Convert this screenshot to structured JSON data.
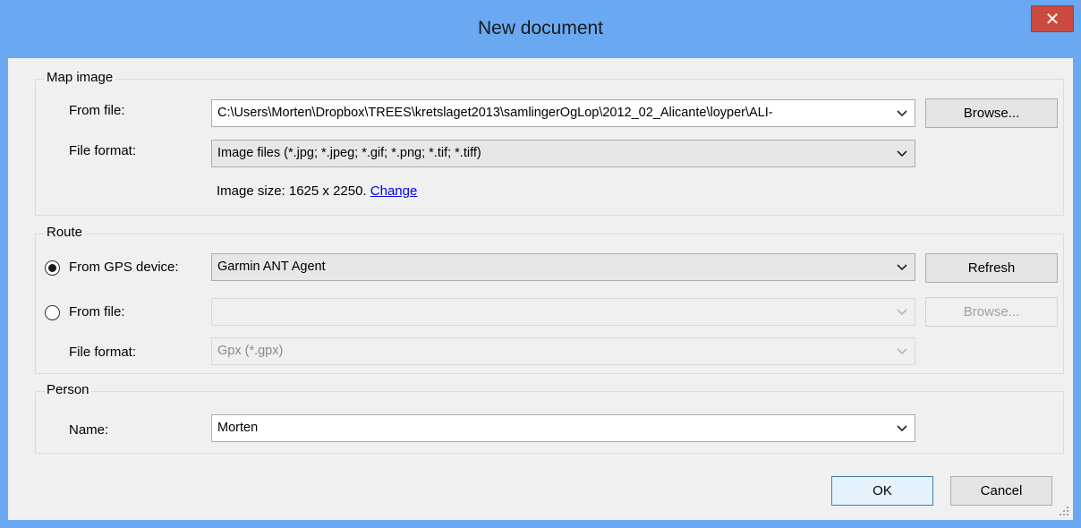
{
  "window": {
    "title": "New document",
    "close_glyph": "✕"
  },
  "map_image": {
    "group_label": "Map image",
    "from_file_label": "From file:",
    "from_file_value": "C:\\Users\\Morten\\Dropbox\\TREES\\kretslaget2013\\samlingerOgLop\\2012_02_Alicante\\loyper\\ALI-",
    "browse_label": "Browse...",
    "file_format_label": "File format:",
    "file_format_value": "Image files  (*.jpg; *.jpeg; *.gif; *.png; *.tif; *.tiff)",
    "image_size_text": "Image size: 1625 x 2250.",
    "change_link": "Change"
  },
  "route": {
    "group_label": "Route",
    "gps_label": "From GPS device:",
    "gps_value": "Garmin ANT Agent",
    "refresh_label": "Refresh",
    "from_file_label": "From file:",
    "from_file_value": "",
    "browse_label": "Browse...",
    "file_format_label": "File format:",
    "file_format_value": "Gpx (*.gpx)",
    "selected_source": "gps"
  },
  "person": {
    "group_label": "Person",
    "name_label": "Name:",
    "name_value": "Morten"
  },
  "footer": {
    "ok_label": "OK",
    "cancel_label": "Cancel"
  },
  "colors": {
    "titlebar": "#6aa9f2",
    "close": "#c94a3e",
    "client": "#f0f0f0",
    "link": "#0000ee"
  },
  "icons": [
    "close-icon",
    "chevron-down-icon",
    "radio-selected-icon",
    "radio-unselected-icon",
    "resize-grip-icon"
  ]
}
